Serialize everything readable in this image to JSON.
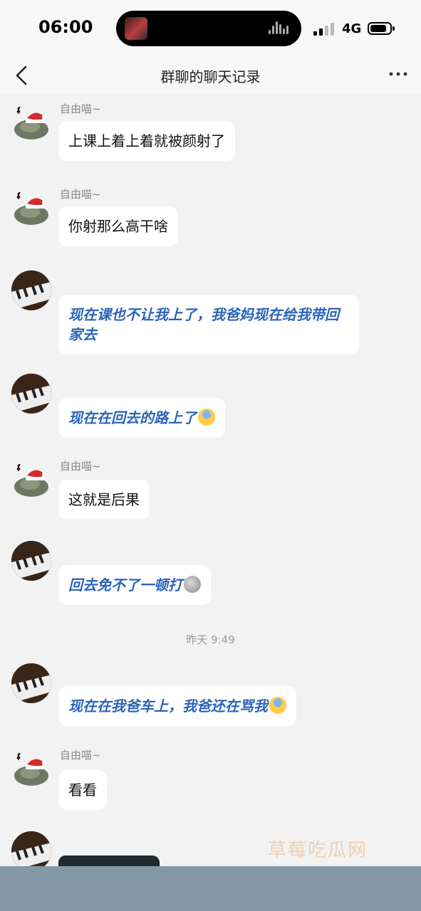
{
  "status_bar": {
    "time": "06:00",
    "network": "4G"
  },
  "nav": {
    "title": "群聊的聊天记录"
  },
  "messages": [
    {
      "sender": "自由喵~",
      "text": "上课上着上着就被颜射了"
    },
    {
      "sender": "自由喵~",
      "text": "你射那么高干啥"
    },
    {
      "text": "现在课也不让我上了，我爸妈现在给我带回家去"
    },
    {
      "text": "现在在回去的路上了",
      "emoji": "fearful-face-emoji"
    },
    {
      "sender": "自由喵~",
      "text": "这就是后果"
    },
    {
      "text": "回去免不了一顿打",
      "emoji": "moon-face-emoji"
    },
    {
      "timestamp": "昨天 9:49"
    },
    {
      "text": "现在在我爸车上，我爸还在骂我",
      "emoji": "fearful-face-emoji"
    },
    {
      "sender": "自由喵~",
      "text": "看看"
    }
  ],
  "watermark": "草莓吃瓜网"
}
